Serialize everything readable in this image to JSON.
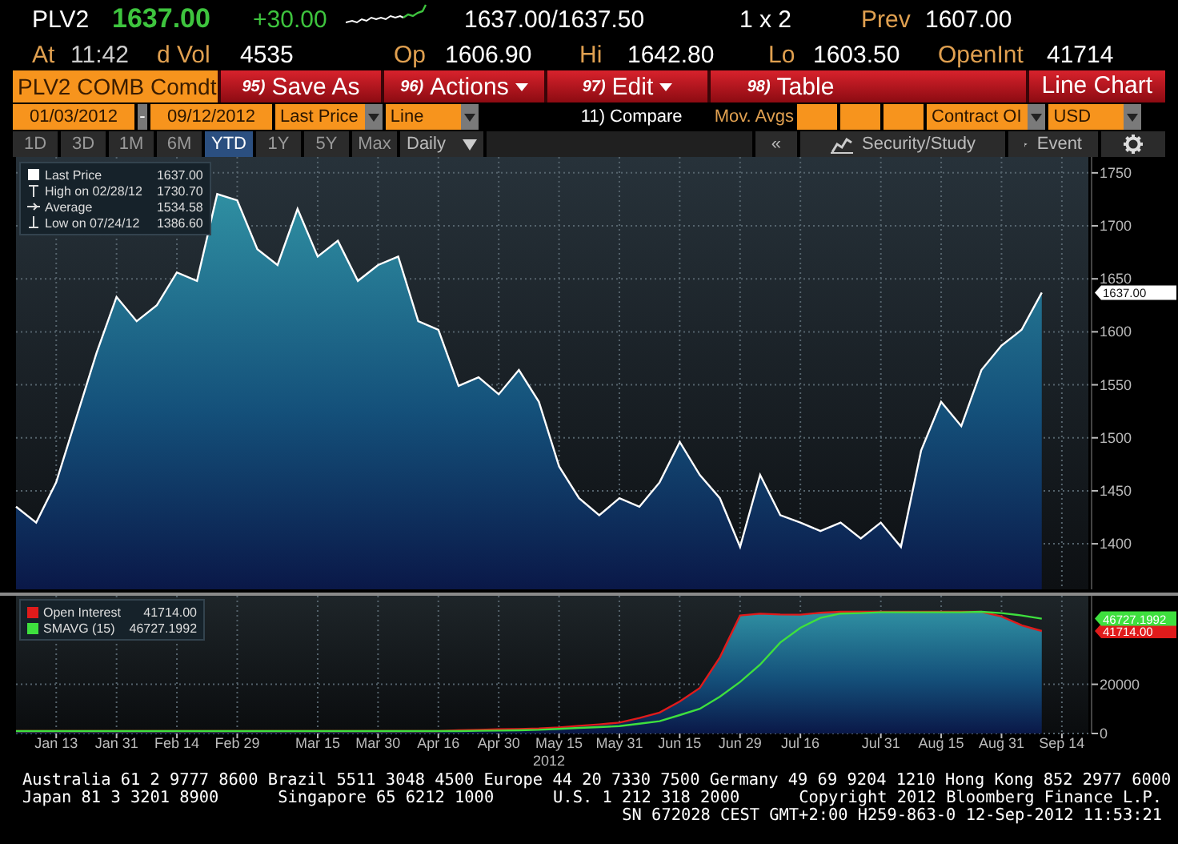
{
  "quote": {
    "ticker": "PLV2",
    "last": "1637.00",
    "change": "+30.00",
    "bid_ask": "1637.00/1637.50",
    "size": "1 x 2",
    "prev": {
      "label": "Prev",
      "value": "1607.00"
    }
  },
  "stats": [
    {
      "label": "At",
      "value": "11:42"
    },
    {
      "label": "d Vol",
      "value": "4535"
    },
    {
      "label": "Op",
      "value": "1606.90"
    },
    {
      "label": "Hi",
      "value": "1642.80"
    },
    {
      "label": "Lo",
      "value": "1603.50"
    },
    {
      "label": "OpenInt",
      "value": "41714"
    }
  ],
  "toolbar": {
    "security": "PLV2 COMB Comdt",
    "buttons": [
      {
        "number": "95)",
        "label": "Save As",
        "dropdown": false
      },
      {
        "number": "96)",
        "label": "Actions",
        "dropdown": true
      },
      {
        "number": "97)",
        "label": "Edit",
        "dropdown": true
      },
      {
        "number": "98)",
        "label": "Table",
        "dropdown": false
      }
    ],
    "title": "Line Chart"
  },
  "filters": [
    {
      "kind": "field",
      "text": "01/03/2012"
    },
    {
      "kind": "separator",
      "text": "-"
    },
    {
      "kind": "field",
      "text": "09/12/2012"
    },
    {
      "kind": "dropdown",
      "text": "Last Price"
    },
    {
      "kind": "dropdown",
      "text": "Line"
    },
    {
      "kind": "link",
      "text": "11) Compare"
    },
    {
      "kind": "label",
      "text": "Mov. Avgs"
    },
    {
      "kind": "blank"
    },
    {
      "kind": "blank"
    },
    {
      "kind": "blank"
    },
    {
      "kind": "dropdown",
      "text": "Contract OI"
    },
    {
      "kind": "dropdown",
      "text": "USD"
    }
  ],
  "tabs": {
    "periods": [
      {
        "label": "1D",
        "selected": false
      },
      {
        "label": "3D",
        "selected": false
      },
      {
        "label": "1M",
        "selected": false
      },
      {
        "label": "6M",
        "selected": false
      },
      {
        "label": "YTD",
        "selected": true
      },
      {
        "label": "1Y",
        "selected": false
      },
      {
        "label": "5Y",
        "selected": false
      },
      {
        "label": "Max",
        "selected": false
      }
    ],
    "frequency": "Daily",
    "collapse": "«",
    "study": "Security/Study",
    "event": "Event"
  },
  "main": {
    "legend": [
      {
        "kind": "last",
        "value": "1637.00"
      },
      {
        "kind": "high",
        "label": "High on 02/28/12",
        "value": "1730.70"
      },
      {
        "kind": "average",
        "label": "Average",
        "value": "1534.58"
      },
      {
        "kind": "low",
        "label": "Low on 07/24/12",
        "value": "1386.60"
      }
    ],
    "chart_data": {
      "type": "area",
      "grid": true,
      "categories": [
        null,
        null,
        null,
        null,
        null,
        null,
        null,
        null,
        null,
        null,
        null,
        null,
        null,
        null,
        null,
        null,
        null,
        null,
        null,
        null,
        null,
        null,
        null,
        null,
        null,
        null,
        null,
        null,
        null,
        null,
        null,
        null,
        null,
        null,
        null,
        null,
        null,
        null,
        null,
        null,
        null,
        null,
        null,
        null,
        null,
        null,
        null,
        null,
        null,
        null,
        null,
        null,
        null
      ],
      "ylim": [
        1357,
        1765
      ],
      "yticks": [
        1400,
        1450,
        1500,
        1550,
        1600,
        1650,
        1700,
        1750
      ],
      "series": [
        {
          "name": "Last Price",
          "color": "#ffffff",
          "type": "area",
          "values": [
            1435,
            1420,
            1458,
            1519,
            1580,
            1633,
            1610,
            1625,
            1656,
            1648,
            1730,
            1724,
            1678,
            1663,
            1716,
            1671,
            1686,
            1648,
            1663,
            1671,
            1610,
            1602,
            1549,
            1557,
            1541,
            1564,
            1534,
            1473,
            1443,
            1427,
            1443,
            1435,
            1458,
            1496,
            1465,
            1443,
            1397,
            1465,
            1427,
            1420,
            1412,
            1420,
            1405,
            1420,
            1397,
            1488,
            1534,
            1511,
            1564,
            1587,
            1602,
            1637,
            null
          ]
        }
      ],
      "annotations": [
        "1637.00"
      ]
    }
  },
  "lower": {
    "legend_values": [
      "41714.00",
      "46727.1992"
    ],
    "chart_data": {
      "type": "area",
      "grid": true,
      "legend": true,
      "categories": [
        null,
        null,
        "Jan 13",
        null,
        null,
        "Jan 31",
        null,
        null,
        "Feb 14",
        null,
        null,
        "Feb 29",
        null,
        null,
        null,
        "Mar 15",
        null,
        null,
        "Mar 30",
        null,
        null,
        "Apr 16",
        null,
        null,
        "Apr 30",
        null,
        null,
        "May 15",
        null,
        null,
        "May 31",
        null,
        null,
        "Jun 15",
        null,
        null,
        "Jun 29",
        null,
        null,
        "Jul 16",
        null,
        null,
        null,
        "Jul 31",
        null,
        null,
        "Aug 15",
        null,
        null,
        "Aug 31",
        null,
        null,
        "Sep 14"
      ],
      "ylim": [
        0,
        56000
      ],
      "yticks": [
        0,
        20000
      ],
      "xlabel": "2012",
      "series": [
        {
          "name": "Open Interest",
          "color": "#e01b1b",
          "type": "area",
          "values": [
            1000,
            1000,
            1000,
            1000,
            1000,
            1000,
            1000,
            1000,
            1000,
            1000,
            1000,
            1000,
            1000,
            1000,
            1000,
            1000,
            1000,
            1000,
            1000,
            1000,
            1000,
            1000,
            1300,
            1500,
            1700,
            1800,
            2000,
            2500,
            3100,
            3700,
            4400,
            6300,
            8500,
            13000,
            18500,
            31000,
            48000,
            48700,
            48400,
            48300,
            49100,
            49500,
            49500,
            49500,
            49500,
            49500,
            49500,
            49500,
            49500,
            47600,
            44000,
            41700,
            null
          ]
        },
        {
          "name": "SMAVG (15)",
          "color": "#3ee03e",
          "type": "line",
          "values": [
            1000,
            1000,
            1000,
            1000,
            1000,
            1000,
            1000,
            1000,
            1000,
            1000,
            1000,
            1000,
            1000,
            1000,
            1000,
            1000,
            1000,
            1000,
            1000,
            1000,
            1000,
            1000,
            1000,
            1100,
            1200,
            1300,
            1500,
            1900,
            2300,
            2600,
            3000,
            4000,
            5000,
            7500,
            10000,
            15000,
            21000,
            28000,
            37000,
            43000,
            47000,
            48800,
            49000,
            49300,
            49300,
            49300,
            49300,
            49300,
            49500,
            49000,
            48000,
            46700,
            null
          ]
        }
      ],
      "annotations": [
        "41714.00",
        "46727.1992"
      ]
    }
  },
  "footer": {
    "lines": [
      [
        "Australia 61 2 9777 8600 Brazil 5511 3048 4500 Europe 44 20 7330 7500 Germany 49 69 9204 1210 Hong Kong 852 2977 6000"
      ],
      [
        "Japan 81 3 3201 8900",
        "Singapore 65 6212 1000",
        "U.S. 1 212 318 2000",
        "Copyright 2012 Bloomberg Finance L.P."
      ],
      [
        "SN 672028 CEST GMT+2:00 H259-863-0 12-Sep-2012 11:53:21"
      ]
    ]
  }
}
